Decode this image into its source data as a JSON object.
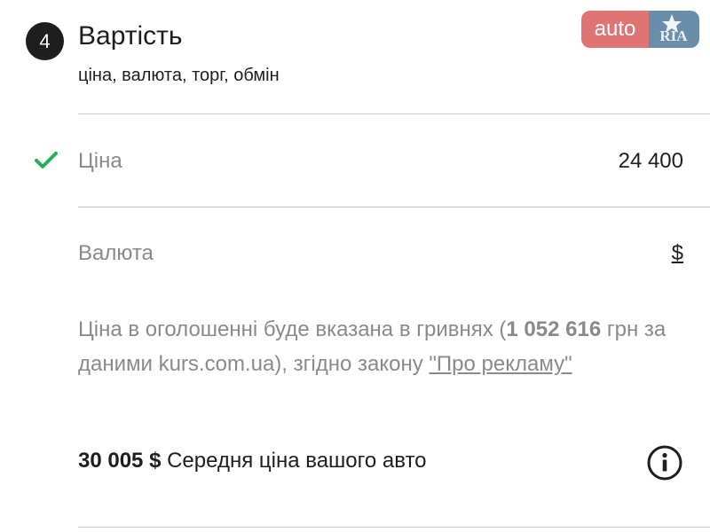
{
  "step": {
    "number": "4"
  },
  "section": {
    "title": "Вартість",
    "subtitle": "ціна, валюта, торг, обмін"
  },
  "logo": {
    "auto_text": "auto",
    "ria_text": "RIA",
    "icon": "autoria-logo"
  },
  "price": {
    "label": "Ціна",
    "value": "24 400",
    "icon": "check-icon"
  },
  "currency": {
    "label": "Валюта",
    "value": "$"
  },
  "note": {
    "text_before": "Ціна в оголошенні буде вказана в гривнях (",
    "uah_amount": "1 052 616",
    "text_after": " грн за даними kurs.com.ua), згідно закону ",
    "link_text": "\"Про рекламу\""
  },
  "average": {
    "amount": "30 005 $",
    "label": "Середня ціна вашого авто",
    "icon": "info-icon"
  },
  "colors": {
    "check": "#1fb25a",
    "logo_auto": "#e07474",
    "logo_ria": "#6a8eaa",
    "text_muted": "#8a8a8a"
  }
}
